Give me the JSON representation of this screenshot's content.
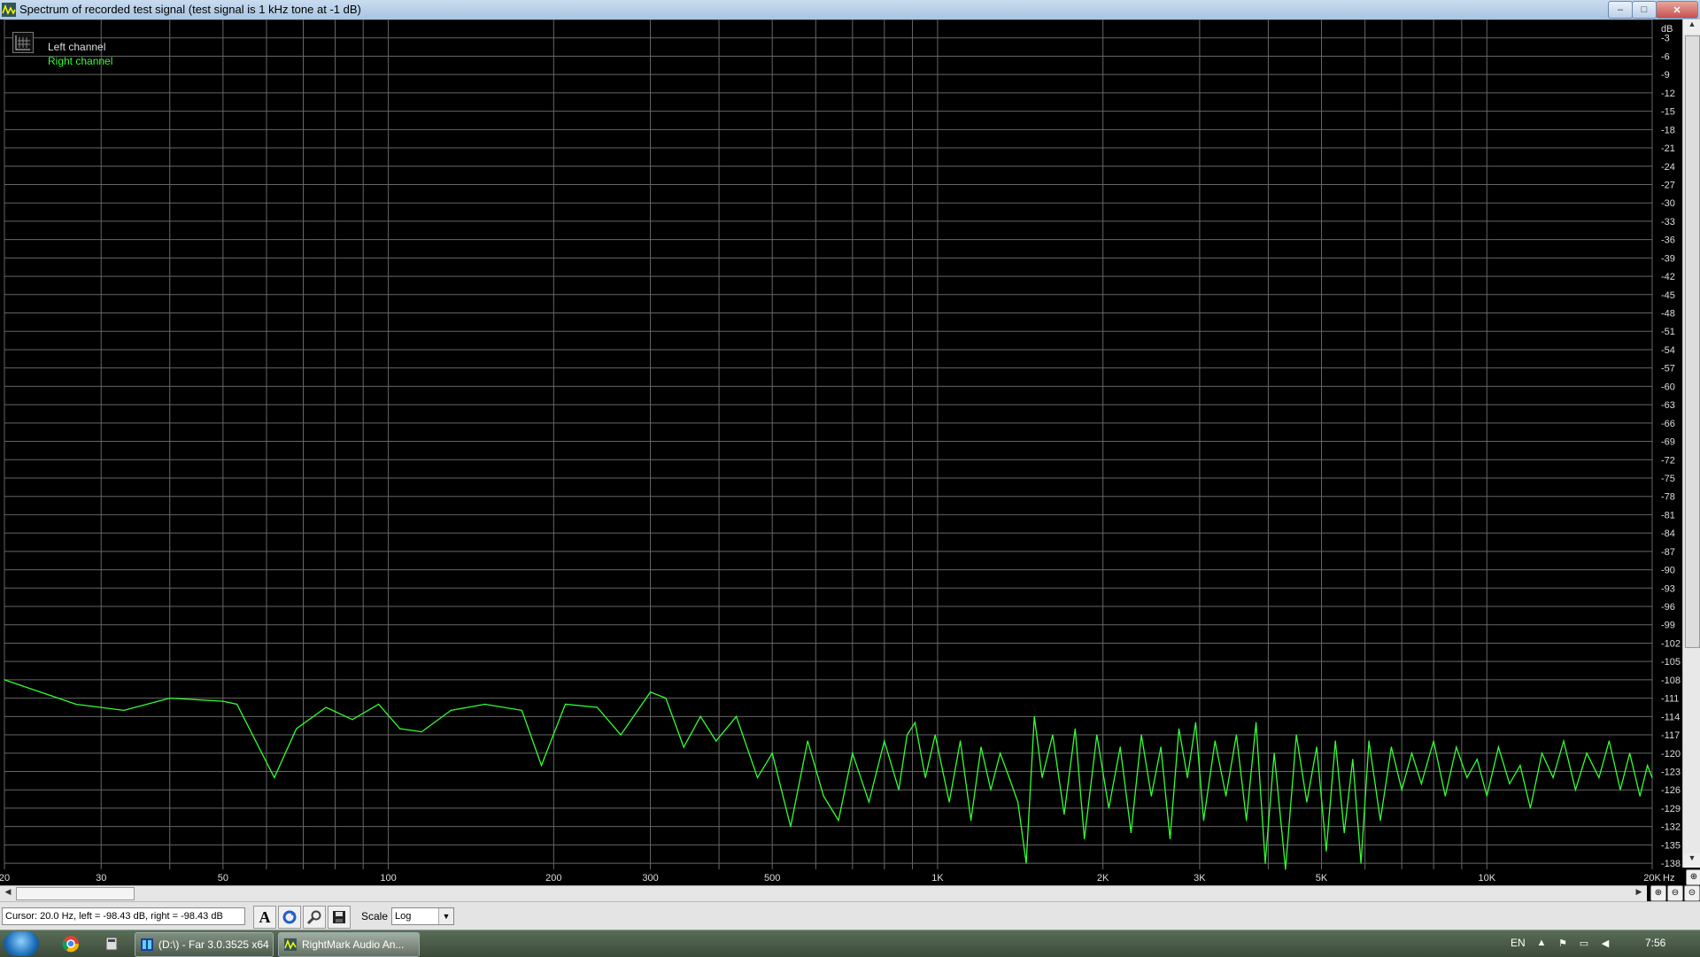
{
  "window": {
    "title": "Spectrum of recorded test signal (test signal is 1 kHz tone at -1 dB)",
    "minimize_glyph": "–",
    "maximize_glyph": "□",
    "close_glyph": "✕"
  },
  "legend": {
    "left_channel": "Left channel",
    "right_channel": "Right channel"
  },
  "statusbar": {
    "cursor_text": "Cursor:  20.0 Hz,  left = -98.43 dB,  right = -98.43 dB",
    "scale_label": "Scale",
    "scale_value": "Log"
  },
  "taskbar": {
    "task1": "(D:\\) - Far 3.0.3525 x64",
    "task2": "RightMark Audio An...",
    "lang": "EN",
    "clock": "7:56"
  },
  "colors": {
    "right_channel": "#33ff33",
    "grid": "#666666",
    "background": "#000000"
  },
  "chart_data": {
    "type": "line",
    "xlabel": "Hz",
    "ylabel": "dB",
    "x_scale": "log",
    "xlim": [
      20,
      20000
    ],
    "ylim": [
      -139,
      0
    ],
    "grid": true,
    "legend_position": "top-left",
    "x_ticks": [
      {
        "v": 20,
        "label": "20"
      },
      {
        "v": 30,
        "label": "30"
      },
      {
        "v": 50,
        "label": "50"
      },
      {
        "v": 100,
        "label": "100"
      },
      {
        "v": 200,
        "label": "200"
      },
      {
        "v": 300,
        "label": "300"
      },
      {
        "v": 500,
        "label": "500"
      },
      {
        "v": 1000,
        "label": "1K"
      },
      {
        "v": 2000,
        "label": "2K"
      },
      {
        "v": 3000,
        "label": "3K"
      },
      {
        "v": 5000,
        "label": "5K"
      },
      {
        "v": 10000,
        "label": "10K"
      },
      {
        "v": 20000,
        "label": "20K"
      }
    ],
    "y_ticks": [
      -3,
      -6,
      -9,
      -12,
      -15,
      -18,
      -21,
      -24,
      -27,
      -30,
      -33,
      -36,
      -39,
      -42,
      -45,
      -48,
      -51,
      -54,
      -57,
      -60,
      -63,
      -66,
      -69,
      -72,
      -75,
      -78,
      -81,
      -84,
      -87,
      -90,
      -93,
      -96,
      -99,
      -102,
      -105,
      -108,
      -111,
      -114,
      -117,
      -120,
      -123,
      -126,
      -129,
      -132,
      -135,
      -138
    ],
    "series": [
      {
        "name": "Right channel",
        "points": [
          [
            20,
            -108
          ],
          [
            27,
            -112
          ],
          [
            33,
            -113
          ],
          [
            40,
            -111
          ],
          [
            50,
            -111.5
          ],
          [
            53,
            -112
          ],
          [
            62,
            -124
          ],
          [
            68,
            -116
          ],
          [
            77,
            -112.5
          ],
          [
            86,
            -114.5
          ],
          [
            96,
            -112
          ],
          [
            105,
            -116
          ],
          [
            115,
            -116.5
          ],
          [
            130,
            -113
          ],
          [
            150,
            -112
          ],
          [
            175,
            -113
          ],
          [
            190,
            -122
          ],
          [
            210,
            -112
          ],
          [
            240,
            -112.5
          ],
          [
            265,
            -117
          ],
          [
            300,
            -110
          ],
          [
            320,
            -111
          ],
          [
            345,
            -119
          ],
          [
            370,
            -114
          ],
          [
            395,
            -118
          ],
          [
            430,
            -114
          ],
          [
            470,
            -124
          ],
          [
            500,
            -120
          ],
          [
            540,
            -132
          ],
          [
            580,
            -118
          ],
          [
            620,
            -127
          ],
          [
            660,
            -131
          ],
          [
            700,
            -120
          ],
          [
            750,
            -128
          ],
          [
            800,
            -118
          ],
          [
            850,
            -126
          ],
          [
            880,
            -117
          ],
          [
            910,
            -115
          ],
          [
            950,
            -124
          ],
          [
            990,
            -117
          ],
          [
            1050,
            -128
          ],
          [
            1100,
            -118
          ],
          [
            1150,
            -131
          ],
          [
            1200,
            -119
          ],
          [
            1250,
            -126
          ],
          [
            1300,
            -120
          ],
          [
            1350,
            -124
          ],
          [
            1400,
            -128
          ],
          [
            1450,
            -138
          ],
          [
            1500,
            -114
          ],
          [
            1550,
            -124
          ],
          [
            1620,
            -117
          ],
          [
            1700,
            -130
          ],
          [
            1780,
            -116
          ],
          [
            1850,
            -134
          ],
          [
            1950,
            -117
          ],
          [
            2050,
            -129
          ],
          [
            2150,
            -119
          ],
          [
            2250,
            -133
          ],
          [
            2350,
            -117
          ],
          [
            2450,
            -127
          ],
          [
            2550,
            -119
          ],
          [
            2650,
            -134
          ],
          [
            2750,
            -116
          ],
          [
            2850,
            -124
          ],
          [
            2950,
            -115
          ],
          [
            3050,
            -131
          ],
          [
            3200,
            -118
          ],
          [
            3350,
            -127
          ],
          [
            3500,
            -117
          ],
          [
            3650,
            -131
          ],
          [
            3800,
            -115
          ],
          [
            3950,
            -138
          ],
          [
            4100,
            -120
          ],
          [
            4300,
            -139
          ],
          [
            4500,
            -117
          ],
          [
            4700,
            -128
          ],
          [
            4900,
            -119
          ],
          [
            5100,
            -136
          ],
          [
            5300,
            -118
          ],
          [
            5500,
            -133
          ],
          [
            5700,
            -121
          ],
          [
            5900,
            -138
          ],
          [
            6100,
            -118
          ],
          [
            6400,
            -131
          ],
          [
            6700,
            -119
          ],
          [
            7000,
            -126
          ],
          [
            7300,
            -120
          ],
          [
            7600,
            -125
          ],
          [
            8000,
            -118
          ],
          [
            8400,
            -127
          ],
          [
            8800,
            -119
          ],
          [
            9200,
            -124
          ],
          [
            9600,
            -121
          ],
          [
            10000,
            -127
          ],
          [
            10500,
            -119
          ],
          [
            11000,
            -125
          ],
          [
            11500,
            -122
          ],
          [
            12000,
            -129
          ],
          [
            12600,
            -120
          ],
          [
            13200,
            -124
          ],
          [
            13800,
            -118
          ],
          [
            14500,
            -126
          ],
          [
            15200,
            -120
          ],
          [
            16000,
            -124
          ],
          [
            16700,
            -118
          ],
          [
            17500,
            -126
          ],
          [
            18200,
            -120
          ],
          [
            19000,
            -127
          ],
          [
            19600,
            -122
          ],
          [
            20000,
            -124
          ]
        ]
      }
    ]
  }
}
